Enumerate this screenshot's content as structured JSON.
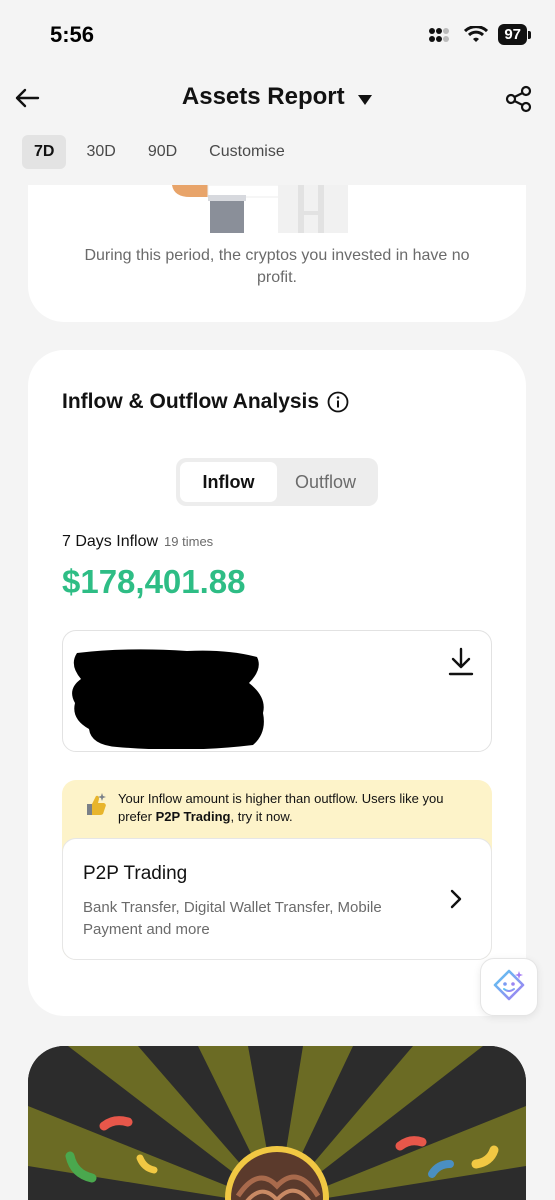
{
  "status": {
    "time": "5:56",
    "battery": "97"
  },
  "header": {
    "title": "Assets Report"
  },
  "period_tabs": [
    {
      "label": "7D"
    },
    {
      "label": "30D"
    },
    {
      "label": "90D"
    },
    {
      "label": "Customise"
    }
  ],
  "no_profit": {
    "text": "During this period, the cryptos you invested in have no profit."
  },
  "analysis": {
    "title": "Inflow & Outflow Analysis",
    "toggle": {
      "inflow": "Inflow",
      "outflow": "Outflow"
    },
    "inflow_label": "7 Days Inflow",
    "inflow_times": "19 times",
    "inflow_amount": "$178,401.88"
  },
  "tip": {
    "text_before": "Your Inflow amount is higher than outflow. Users like you prefer ",
    "highlight": "P2P Trading",
    "text_after": ", try it now."
  },
  "p2p": {
    "title": "P2P Trading",
    "description": "Bank Transfer, Digital Wallet Transfer, Mobile Payment and more"
  },
  "colors": {
    "accent_green": "#2ebd85",
    "tip_bg": "#fdf3c9"
  }
}
